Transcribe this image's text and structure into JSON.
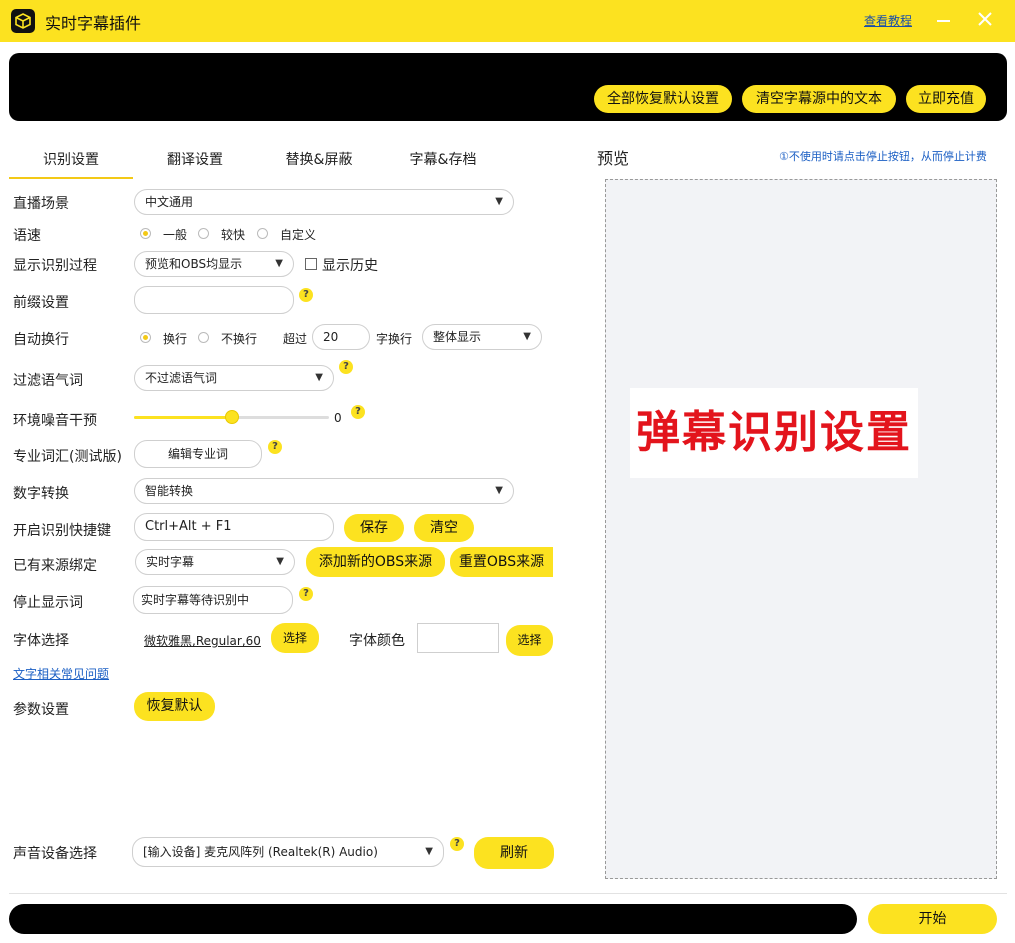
{
  "app": {
    "title": "实时字幕插件",
    "tutorial_link": "查看教程"
  },
  "banner": {
    "reset_all": "全部恢复默认设置",
    "clear_text": "清空字幕源中的文本",
    "recharge": "立即充值"
  },
  "tabs": [
    {
      "label": "识别设置",
      "active": true
    },
    {
      "label": "翻译设置",
      "active": false
    },
    {
      "label": "替换&屏蔽",
      "active": false
    },
    {
      "label": "字幕&存档",
      "active": false
    }
  ],
  "form": {
    "scene": {
      "label": "直播场景",
      "value": "中文通用"
    },
    "speed": {
      "label": "语速",
      "options": [
        "一般",
        "较快",
        "自定义"
      ],
      "selected": "一般"
    },
    "show_process": {
      "label": "显示识别过程",
      "value": "预览和OBS均显示",
      "history_label": "显示历史",
      "history_checked": false
    },
    "prefix": {
      "label": "前缀设置",
      "value": ""
    },
    "wrap": {
      "label": "自动换行",
      "options": [
        "换行",
        "不换行"
      ],
      "selected": "换行",
      "exceed_label": "超过",
      "exceed_value": "20",
      "chars_label": "字换行",
      "display_mode": "整体显示"
    },
    "filler": {
      "label": "过滤语气词",
      "value": "不过滤语气词"
    },
    "noise": {
      "label": "环境噪音干预",
      "value": 0,
      "position_percent": 50
    },
    "vocab": {
      "label": "专业词汇(测试版)",
      "button": "编辑专业词"
    },
    "number": {
      "label": "数字转换",
      "value": "智能转换"
    },
    "hotkey": {
      "label": "开启识别快捷键",
      "value": "Ctrl+Alt + F1",
      "save": "保存",
      "clear": "清空"
    },
    "source": {
      "label": "已有来源绑定",
      "value": "实时字幕",
      "add": "添加新的OBS来源",
      "reset": "重置OBS来源"
    },
    "stop_word": {
      "label": "停止显示词",
      "value": "实时字幕等待识别中"
    },
    "font": {
      "label": "字体选择",
      "value": "微软雅黑,Regular,60",
      "select": "选择",
      "color_label": "字体颜色",
      "color_select": "选择"
    },
    "faq_link": "文字相关常见问题",
    "params": {
      "label": "参数设置",
      "button": "恢复默认"
    },
    "audio": {
      "label": "声音设备选择",
      "value": "[输入设备] 麦克风阵列 (Realtek(R) Audio)",
      "refresh": "刷新"
    }
  },
  "preview": {
    "title": "预览",
    "note": "①不使用时请点击停止按钮，从而停止计费",
    "image_text": "弹幕识别设置"
  },
  "footer": {
    "start": "开始"
  },
  "colors": {
    "accent": "#fce220",
    "dark": "#000000",
    "link": "#1b5fc4",
    "preview_text": "#e3141c"
  }
}
